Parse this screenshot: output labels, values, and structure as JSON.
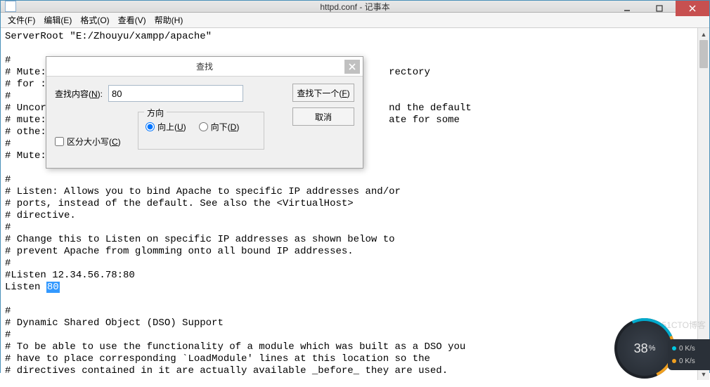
{
  "window": {
    "title": "httpd.conf - 记事本"
  },
  "menu": {
    "file": "文件(F)",
    "edit": "编辑(E)",
    "format": "格式(O)",
    "view": "查看(V)",
    "help": "帮助(H)"
  },
  "editor": {
    "lines": [
      "ServerRoot \"E:/Zhouyu/xampp/apache\"",
      "",
      "#",
      "# Mute:                                                          rectory",
      "# for :",
      "#",
      "# Uncor                                                          nd the default",
      "# mute:                                                          ate for some",
      "# othe:",
      "#",
      "# Mute:",
      "",
      "#",
      "# Listen: Allows you to bind Apache to specific IP addresses and/or",
      "# ports, instead of the default. See also the <VirtualHost>",
      "# directive.",
      "#",
      "# Change this to Listen on specific IP addresses as shown below to",
      "# prevent Apache from glomming onto all bound IP addresses.",
      "#",
      "#Listen 12.34.56.78:80",
      "Listen ",
      "",
      "#",
      "# Dynamic Shared Object (DSO) Support",
      "#",
      "# To be able to use the functionality of a module which was built as a DSO you",
      "# have to place corresponding `LoadModule' lines at this location so the",
      "# directives contained in it are actually available _before_ they are used."
    ],
    "highlight_value": "80"
  },
  "find_dialog": {
    "title": "查找",
    "label_find_what": "查找内容(N):",
    "input_value": "80",
    "btn_find_next": "查找下一个(F)",
    "btn_cancel": "取消",
    "group_direction": "方向",
    "radio_up": "向上(U)",
    "radio_down": "向下(D)",
    "chk_match_case": "区分大小写(C)",
    "radio_selected": "up"
  },
  "gauge": {
    "percent": "38",
    "unit": "%"
  },
  "net": {
    "up": "0 K/s",
    "down": "0 K/s"
  },
  "watermark": "@51CTO博客"
}
